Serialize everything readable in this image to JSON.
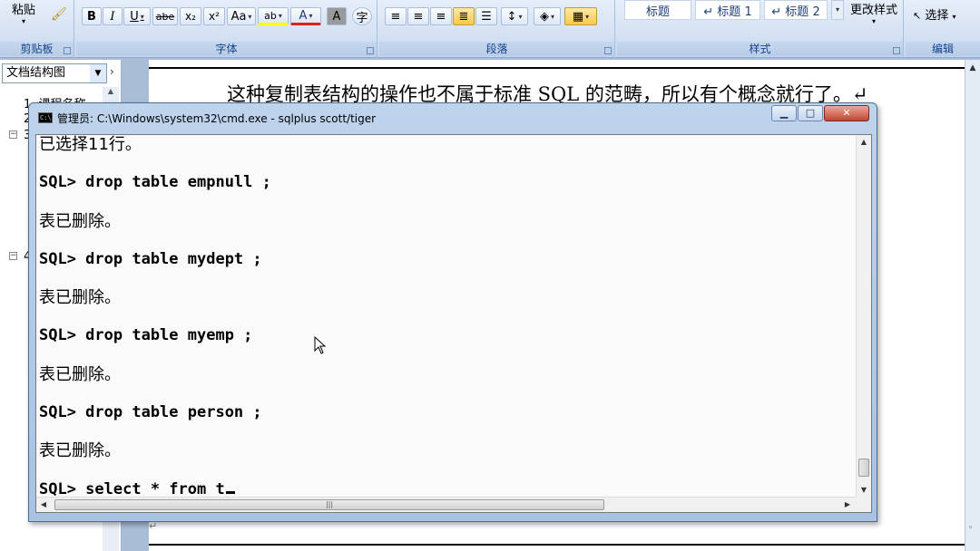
{
  "ribbon": {
    "clipboard": {
      "paste_label": "粘贴",
      "group_label": "剪贴板"
    },
    "font": {
      "group_label": "字体",
      "buttons": [
        "B",
        "I",
        "U",
        "abe",
        "x₂",
        "x²",
        "Aa",
        "ab",
        "A",
        "A",
        "字"
      ]
    },
    "paragraph": {
      "group_label": "段落"
    },
    "styles": {
      "items": [
        "标题",
        "↵ 标题 1",
        "↵ 标题 2"
      ],
      "change_styles": "更改样式",
      "group_label": "样式"
    },
    "editing": {
      "select_label": "选择",
      "group_label": "编辑"
    }
  },
  "nav": {
    "dropdown_value": "文档结构图",
    "items": [
      {
        "num": "1",
        "label": "课程名称"
      },
      {
        "num": "2",
        "label": ""
      },
      {
        "num": "3",
        "label": ""
      },
      {
        "num": "4",
        "label": ""
      }
    ]
  },
  "document": {
    "line1": "这种复制表结构的操作也不属于标准 SQL 的范畴，所以有个概念就行了。↵"
  },
  "cmd": {
    "title": "管理员: C:\\Windows\\system32\\cmd.exe - sqlplus  scott/tiger",
    "icon_text": "C:\\",
    "lines": [
      {
        "type": "txt",
        "text": "已选择11行。"
      },
      {
        "type": "sql",
        "text": "SQL> drop table empnull ;"
      },
      {
        "type": "txt",
        "text": "表已删除。"
      },
      {
        "type": "sql",
        "text": "SQL> drop table mydept ;"
      },
      {
        "type": "txt",
        "text": "表已删除。"
      },
      {
        "type": "sql",
        "text": "SQL> drop table myemp ;"
      },
      {
        "type": "txt",
        "text": "表已删除。"
      },
      {
        "type": "sql",
        "text": "SQL> drop table person ;"
      },
      {
        "type": "txt",
        "text": "表已删除。"
      },
      {
        "type": "sql",
        "text": "SQL> select * from t"
      }
    ],
    "minimize": "▁",
    "maximize": "□",
    "close": "✕"
  }
}
